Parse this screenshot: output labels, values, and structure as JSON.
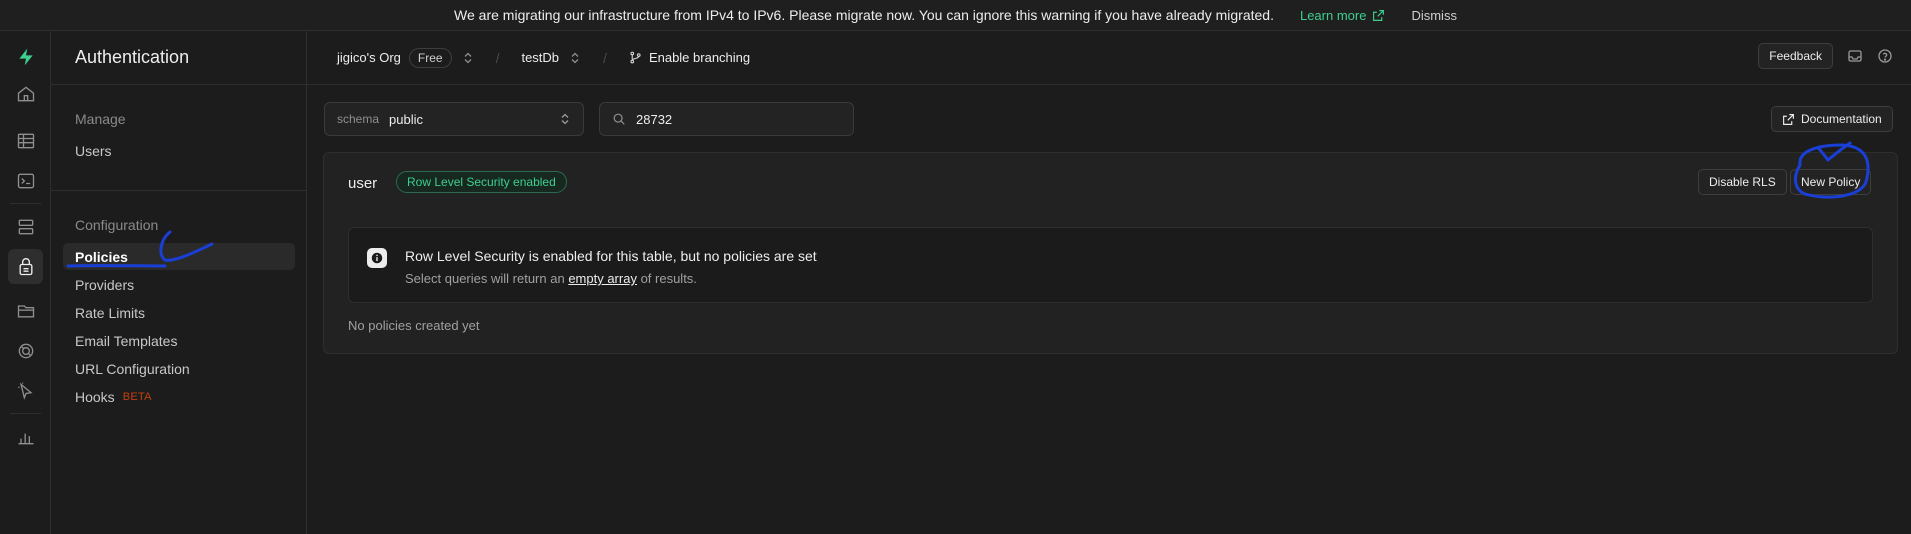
{
  "banner": {
    "message": "We are migrating our infrastructure from IPv4 to IPv6. Please migrate now. You can ignore this warning if you have already migrated.",
    "learn_more": "Learn more",
    "dismiss": "Dismiss"
  },
  "rail": {
    "icons": [
      "supabase-logo-icon",
      "home-icon",
      "table-editor-icon",
      "sql-editor-icon",
      "database-icon",
      "auth-icon",
      "storage-icon",
      "realtime-icon",
      "edge-functions-icon",
      "reports-icon"
    ],
    "active": "auth-icon"
  },
  "sidemenu": {
    "title": "Authentication",
    "manage_label": "Manage",
    "users": "Users",
    "configuration_label": "Configuration",
    "items": [
      "Policies",
      "Providers",
      "Rate Limits",
      "Email Templates",
      "URL Configuration",
      "Hooks"
    ],
    "hooks_badge": "BETA",
    "active_item": "Policies"
  },
  "header": {
    "org": "jigico's Org",
    "plan": "Free",
    "project": "testDb",
    "branching": "Enable branching",
    "feedback": "Feedback"
  },
  "toolbar": {
    "schema_label": "schema",
    "schema_value": "public",
    "search_value": "28732",
    "documentation": "Documentation"
  },
  "table": {
    "name": "user",
    "rls_badge": "Row Level Security enabled",
    "disable_rls": "Disable RLS",
    "new_policy": "New Policy",
    "alert_title": "Row Level Security is enabled for this table, but no policies are set",
    "alert_body_prefix": "Select queries will return an ",
    "alert_body_link": "empty array",
    "alert_body_suffix": " of results.",
    "empty": "No policies created yet"
  },
  "colors": {
    "brand": "#3ecf8e",
    "annotation": "#1a3fd6",
    "beta": "#c2410c"
  }
}
